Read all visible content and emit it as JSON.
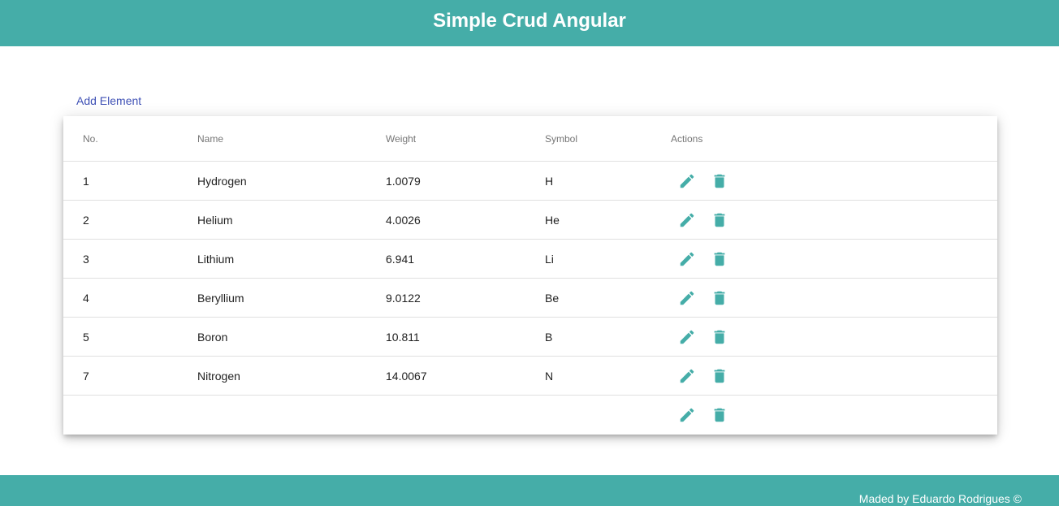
{
  "header": {
    "title": "Simple Crud Angular"
  },
  "toolbar": {
    "add_label": "Add Element"
  },
  "table": {
    "columns": {
      "no": "No.",
      "name": "Name",
      "weight": "Weight",
      "symbol": "Symbol",
      "actions": "Actions"
    },
    "rows": [
      {
        "no": "1",
        "name": "Hydrogen",
        "weight": "1.0079",
        "symbol": "H"
      },
      {
        "no": "2",
        "name": "Helium",
        "weight": "4.0026",
        "symbol": "He"
      },
      {
        "no": "3",
        "name": "Lithium",
        "weight": "6.941",
        "symbol": "Li"
      },
      {
        "no": "4",
        "name": "Beryllium",
        "weight": "9.0122",
        "symbol": "Be"
      },
      {
        "no": "5",
        "name": "Boron",
        "weight": "10.811",
        "symbol": "B"
      },
      {
        "no": "7",
        "name": "Nitrogen",
        "weight": "14.0067",
        "symbol": "N"
      },
      {
        "no": "",
        "name": "",
        "weight": "",
        "symbol": ""
      }
    ],
    "icons": {
      "edit": "pencil-icon",
      "delete": "trash-icon"
    }
  },
  "footer": {
    "text": "Maded by Eduardo Rodrigues ©"
  },
  "colors": {
    "primary": "#45ada8",
    "link": "#3f51b5",
    "icon": "#45ada8"
  }
}
